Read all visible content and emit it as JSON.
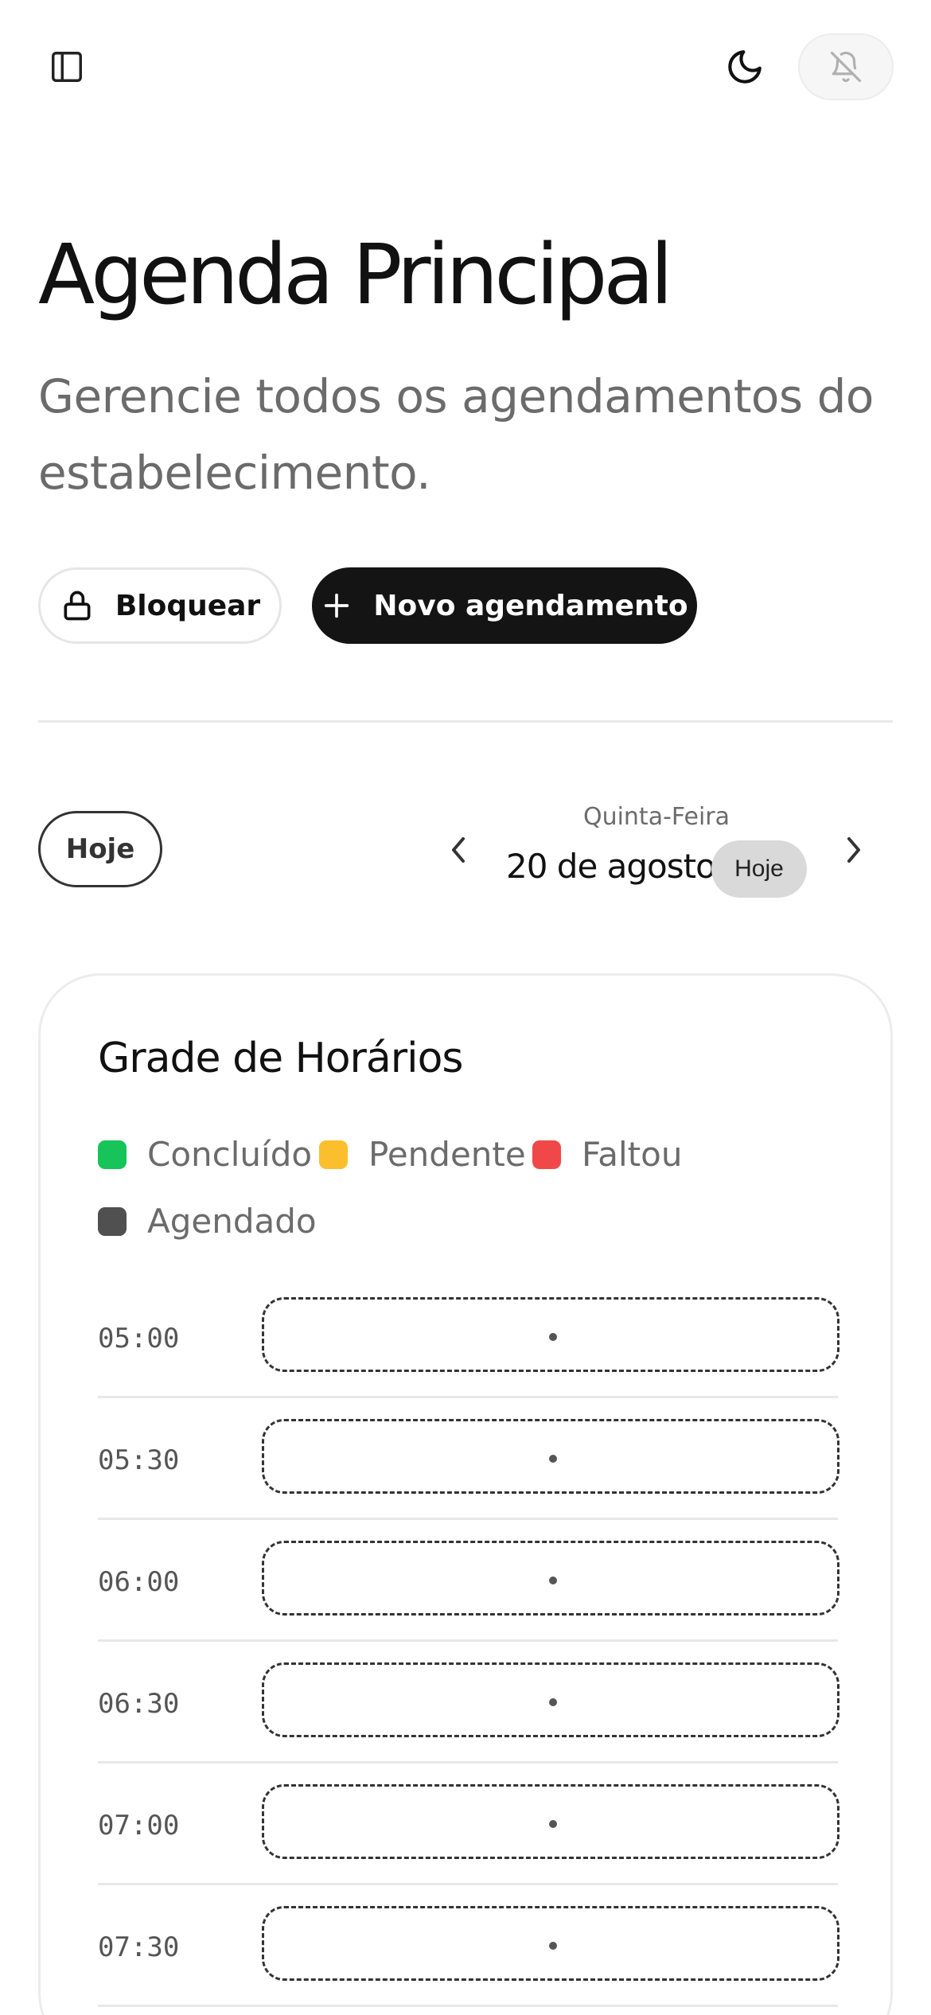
{
  "header": {
    "sidebar_icon": "panel-left-icon",
    "theme_icon": "moon-icon",
    "notifications_icon": "bell-off-icon"
  },
  "page": {
    "title": "Agenda Principal",
    "subtitle": "Gerencie todos os agendamentos do estabelecimento."
  },
  "actions": {
    "block_label": "Bloquear",
    "block_icon": "lock-icon",
    "new_label": "Novo agendamento",
    "new_icon": "plus-icon"
  },
  "date_nav": {
    "today_button": "Hoje",
    "weekday": "Quinta-Feira",
    "date": "20 de agosto",
    "today_badge": "Hoje",
    "prev_icon": "chevron-left-icon",
    "next_icon": "chevron-right-icon"
  },
  "schedule": {
    "title": "Grade de Horários",
    "legend": [
      {
        "label": "Concluído",
        "color": "#16c45a"
      },
      {
        "label": "Pendente",
        "color": "#fbbf2e"
      },
      {
        "label": "Faltou",
        "color": "#f04848"
      },
      {
        "label": "Agendado",
        "color": "#505050"
      }
    ],
    "slots": [
      {
        "time": "05:00"
      },
      {
        "time": "05:30"
      },
      {
        "time": "06:00"
      },
      {
        "time": "06:30"
      },
      {
        "time": "07:00"
      },
      {
        "time": "07:30"
      }
    ]
  }
}
